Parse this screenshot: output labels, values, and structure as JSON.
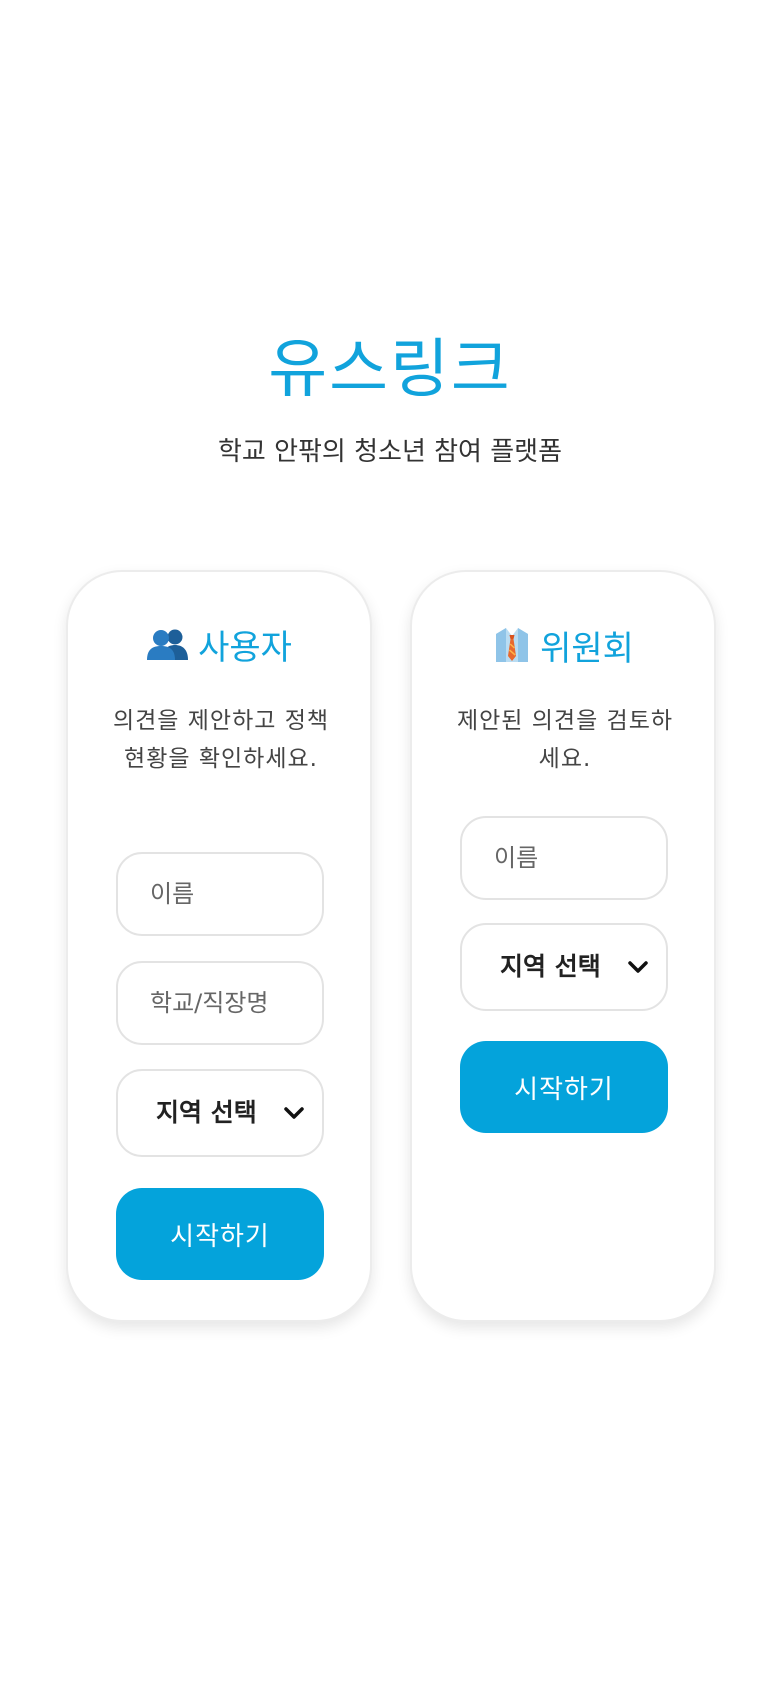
{
  "header": {
    "title": "유스링크",
    "subtitle": "학교 안팎의 청소년 참여 플랫폼"
  },
  "cards": {
    "user": {
      "icon": "people-icon",
      "title": "사용자",
      "description": "의견을 제안하고 정책 현황을 확인하세요.",
      "name_placeholder": "이름",
      "school_placeholder": "학교/직장명",
      "region_select_value": "지역 선택",
      "start_label": "시작하기"
    },
    "committee": {
      "icon": "necktie-shirt-icon",
      "title": "위원회",
      "description": "제안된 의견을 검토하세요.",
      "name_placeholder": "이름",
      "region_select_value": "지역 선택",
      "start_label": "시작하기"
    }
  },
  "colors": {
    "accent": "#11a3dc",
    "button": "#04a3db"
  }
}
